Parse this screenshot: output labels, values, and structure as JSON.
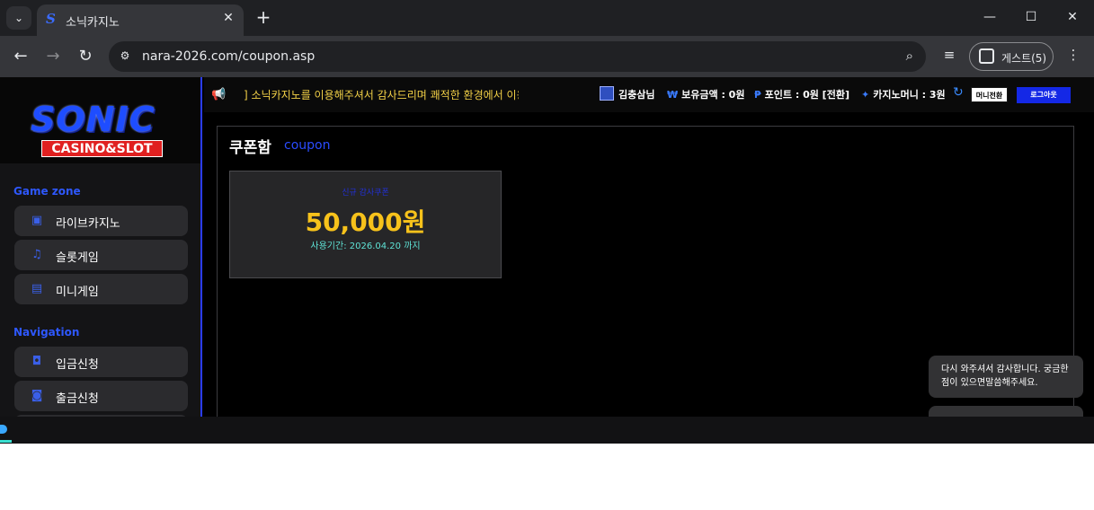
{
  "browser": {
    "tab_title": "소닉카지노",
    "tab_favicon": "S",
    "url": "nara-2026.com/coupon.asp",
    "guest_label": "게스트(5)",
    "accent": "#3b6cff"
  },
  "sidebar": {
    "logo_text": "SONIC",
    "logo_sub": "CASINO&SLOT",
    "game_zone_title": "Game zone",
    "game_items": [
      {
        "label": "라이브카지노",
        "icon": "live-casino-icon"
      },
      {
        "label": "슬롯게임",
        "icon": "slot-icon"
      },
      {
        "label": "미니게임",
        "icon": "mini-game-icon"
      }
    ],
    "navigation_title": "Navigation",
    "nav_items": [
      {
        "label": "입금신청",
        "icon": "deposit-icon"
      },
      {
        "label": "출금신청",
        "icon": "wallet-icon"
      }
    ]
  },
  "infobar": {
    "notice": "] 소닉카지노를 이용해주셔서 감사드리며 쾌적한 환경에서 이용하실 수 있도록 최선을 다하겠습니다",
    "username": "김충삼님",
    "balance_label": "보유금액 : 0원",
    "point_label": "포인트 : 0원 [전환]",
    "casino_money_label": "카지노머니 : 3원",
    "money_convert_label": "머니전환",
    "logout_label": "로그아웃"
  },
  "content": {
    "title": "쿠폰함",
    "subtitle": "coupon",
    "coupons": [
      {
        "name": "신규 감사쿠폰",
        "amount": "50,000원",
        "expiry": "사용기간: 2026.04.20 까지"
      }
    ]
  },
  "chat": {
    "message": "다시 와주셔서 감사합니다. 궁금한점이 있으면말씀해주세요."
  }
}
